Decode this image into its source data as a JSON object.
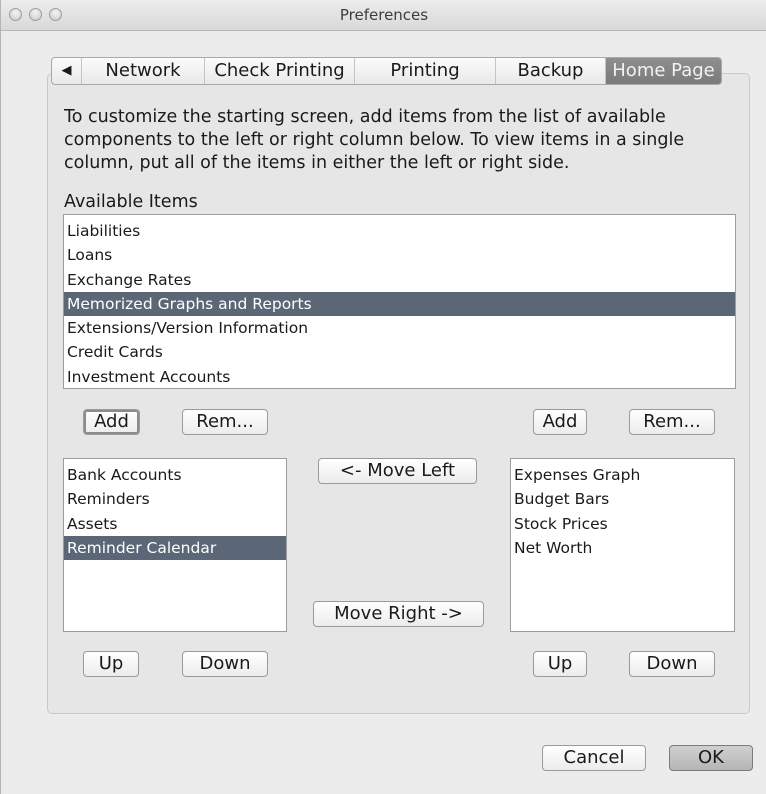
{
  "window": {
    "title": "Preferences"
  },
  "tabs": [
    {
      "label": "Network"
    },
    {
      "label": "Check Printing"
    },
    {
      "label": "Printing"
    },
    {
      "label": "Backup"
    },
    {
      "label": "Home Page",
      "selected": true
    }
  ],
  "description": "To customize the starting screen, add items from the list of available components to the left or right column below.  To view items in a single column, put all of the items in either the left or right side.",
  "available": {
    "label": "Available Items",
    "items": [
      "Liabilities",
      "Loans",
      "Exchange Rates",
      "Memorized Graphs and Reports",
      "Extensions/Version Information",
      "Credit Cards",
      "Investment Accounts"
    ],
    "selected_index": 3
  },
  "left_column": {
    "add_label": "Add",
    "remove_label": "Rem...",
    "up_label": "Up",
    "down_label": "Down",
    "items": [
      "Bank Accounts",
      "Reminders",
      "Assets",
      "Reminder Calendar"
    ],
    "selected_index": 3
  },
  "right_column": {
    "add_label": "Add",
    "remove_label": "Rem...",
    "up_label": "Up",
    "down_label": "Down",
    "items": [
      "Expenses Graph",
      "Budget Bars",
      "Stock Prices",
      "Net Worth"
    ]
  },
  "move": {
    "left_label": "<- Move Left",
    "right_label": "Move Right ->"
  },
  "footer": {
    "cancel_label": "Cancel",
    "ok_label": "OK"
  },
  "colors": {
    "selection": "#5b6777",
    "selected_tab": "#858585",
    "window_bg": "#ececec"
  }
}
